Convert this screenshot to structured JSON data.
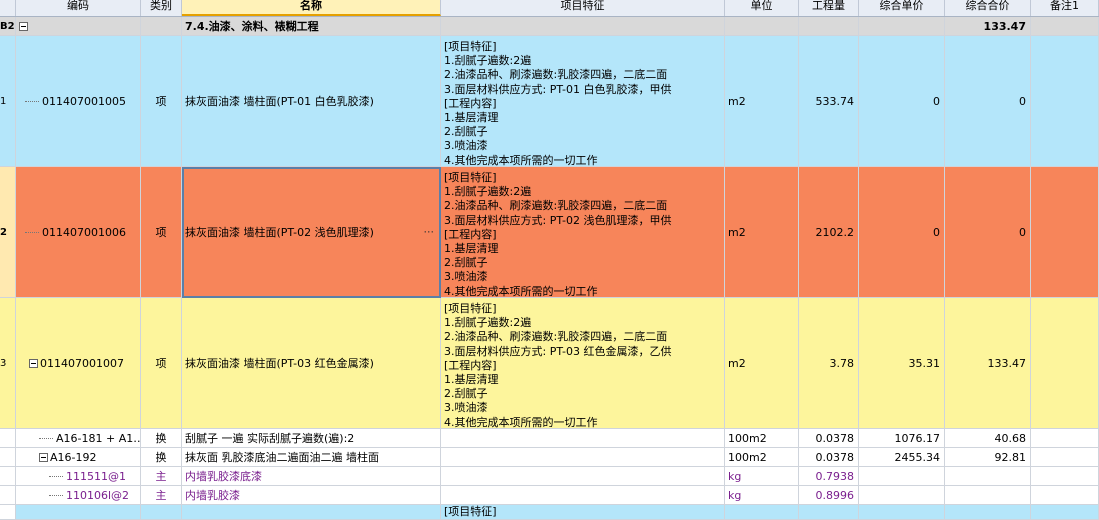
{
  "columns": [
    "编码",
    "类别",
    "名称",
    "项目特征",
    "单位",
    "工程量",
    "综合单价",
    "综合合价",
    "备注1"
  ],
  "section": {
    "rownum": "B2",
    "name": "7.4.油漆、涂料、裱糊工程",
    "total": "133.47"
  },
  "rows": [
    {
      "rownum": "1",
      "code": "011407001005",
      "type": "项",
      "name": "抹灰面油漆 墙柱面(PT-01 白色乳胶漆)",
      "features": "[项目特征]\n1.刮腻子遍数:2遍\n2.油漆品种、刷漆遍数:乳胶漆四遍，二底二面\n3.面层材料供应方式: PT-01 白色乳胶漆，甲供\n[工程内容]\n1.基层清理\n2.刮腻子\n3.喷油漆\n4.其他完成本项所需的一切工作",
      "unit": "m2",
      "qty": "533.74",
      "price": "0",
      "total": "0",
      "bg": "#b4e6fa"
    },
    {
      "rownum": "2",
      "code": "011407001006",
      "type": "项",
      "name": "抹灰面油漆 墙柱面(PT-02 浅色肌理漆)",
      "features": "[项目特征]\n1.刮腻子遍数:2遍\n2.油漆品种、刷漆遍数:乳胶漆四遍，二底二面\n3.面层材料供应方式: PT-02 浅色肌理漆，甲供\n[工程内容]\n1.基层清理\n2.刮腻子\n3.喷油漆\n4.其他完成本项所需的一切工作",
      "unit": "m2",
      "qty": "2102.2",
      "price": "0",
      "total": "0",
      "bg": "#f7855a"
    },
    {
      "rownum": "3",
      "code": "011407001007",
      "type": "项",
      "name": "抹灰面油漆 墙柱面(PT-03 红色金属漆)",
      "features": "[项目特征]\n1.刮腻子遍数:2遍\n2.油漆品种、刷漆遍数:乳胶漆四遍，二底二面\n3.面层材料供应方式: PT-03 红色金属漆，乙供\n[工程内容]\n1.基层清理\n2.刮腻子\n3.喷油漆\n4.其他完成本项所需的一切工作",
      "unit": "m2",
      "qty": "3.78",
      "price": "35.31",
      "total": "133.47",
      "bg": "#fdf59c"
    }
  ],
  "subrows": [
    {
      "code": "A16-181 + A1…",
      "type": "换",
      "name": "刮腻子 一遍  实际刮腻子遍数(遍):2",
      "unit": "100m2",
      "qty": "0.0378",
      "price": "1076.17",
      "total": "40.68"
    },
    {
      "code": "A16-192",
      "type": "换",
      "name": "抹灰面 乳胶漆底油二遍面油二遍 墙柱面",
      "unit": "100m2",
      "qty": "0.0378",
      "price": "2455.34",
      "total": "92.81"
    },
    {
      "code": "111511@1",
      "type": "主",
      "name": "内墙乳胶漆底漆",
      "unit": "kg",
      "qty": "0.7938",
      "price": "",
      "total": ""
    },
    {
      "code": "110106l@2",
      "type": "主",
      "name": "内墙乳胶漆",
      "unit": "kg",
      "qty": "0.8996",
      "price": "",
      "total": ""
    }
  ],
  "last_row": {
    "features": "[项目特征]",
    "bg": "#b4e6fa"
  },
  "colors": {
    "header": "#e8edf5",
    "selected_header": "#fff2b8",
    "purple_text": "#7a1f8e"
  }
}
